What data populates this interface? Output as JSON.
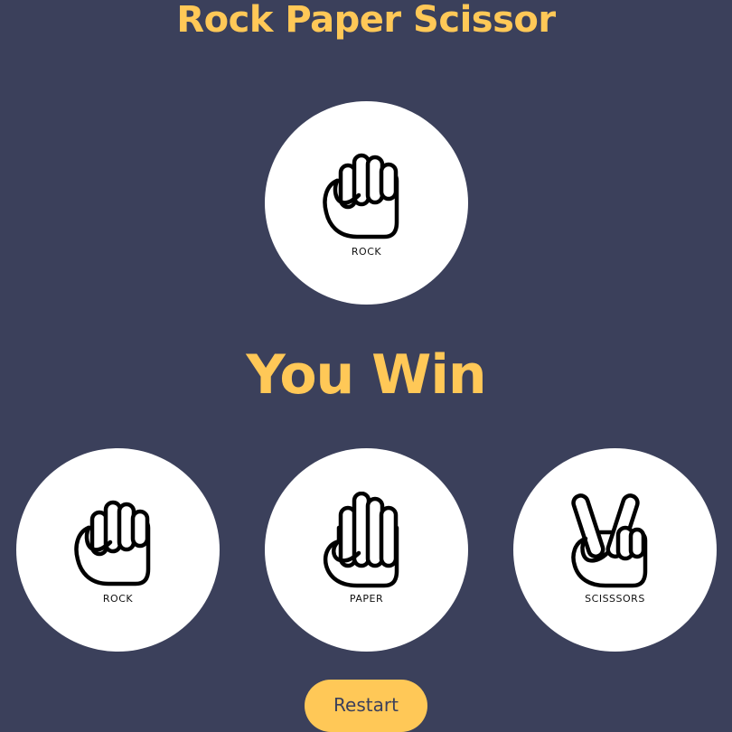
{
  "title": "Rock Paper Scissor",
  "computer_choice": {
    "label": "ROCK",
    "icon": "fist-icon"
  },
  "result_text": "You Win",
  "choices": [
    {
      "label": "ROCK",
      "icon": "fist-icon"
    },
    {
      "label": "PAPER",
      "icon": "open-hand-icon"
    },
    {
      "label": "SCISSSORS",
      "icon": "peace-hand-icon"
    }
  ],
  "restart_label": "Restart",
  "colors": {
    "background": "#3b405b",
    "accent": "#ffc857",
    "circle": "#ffffff"
  }
}
